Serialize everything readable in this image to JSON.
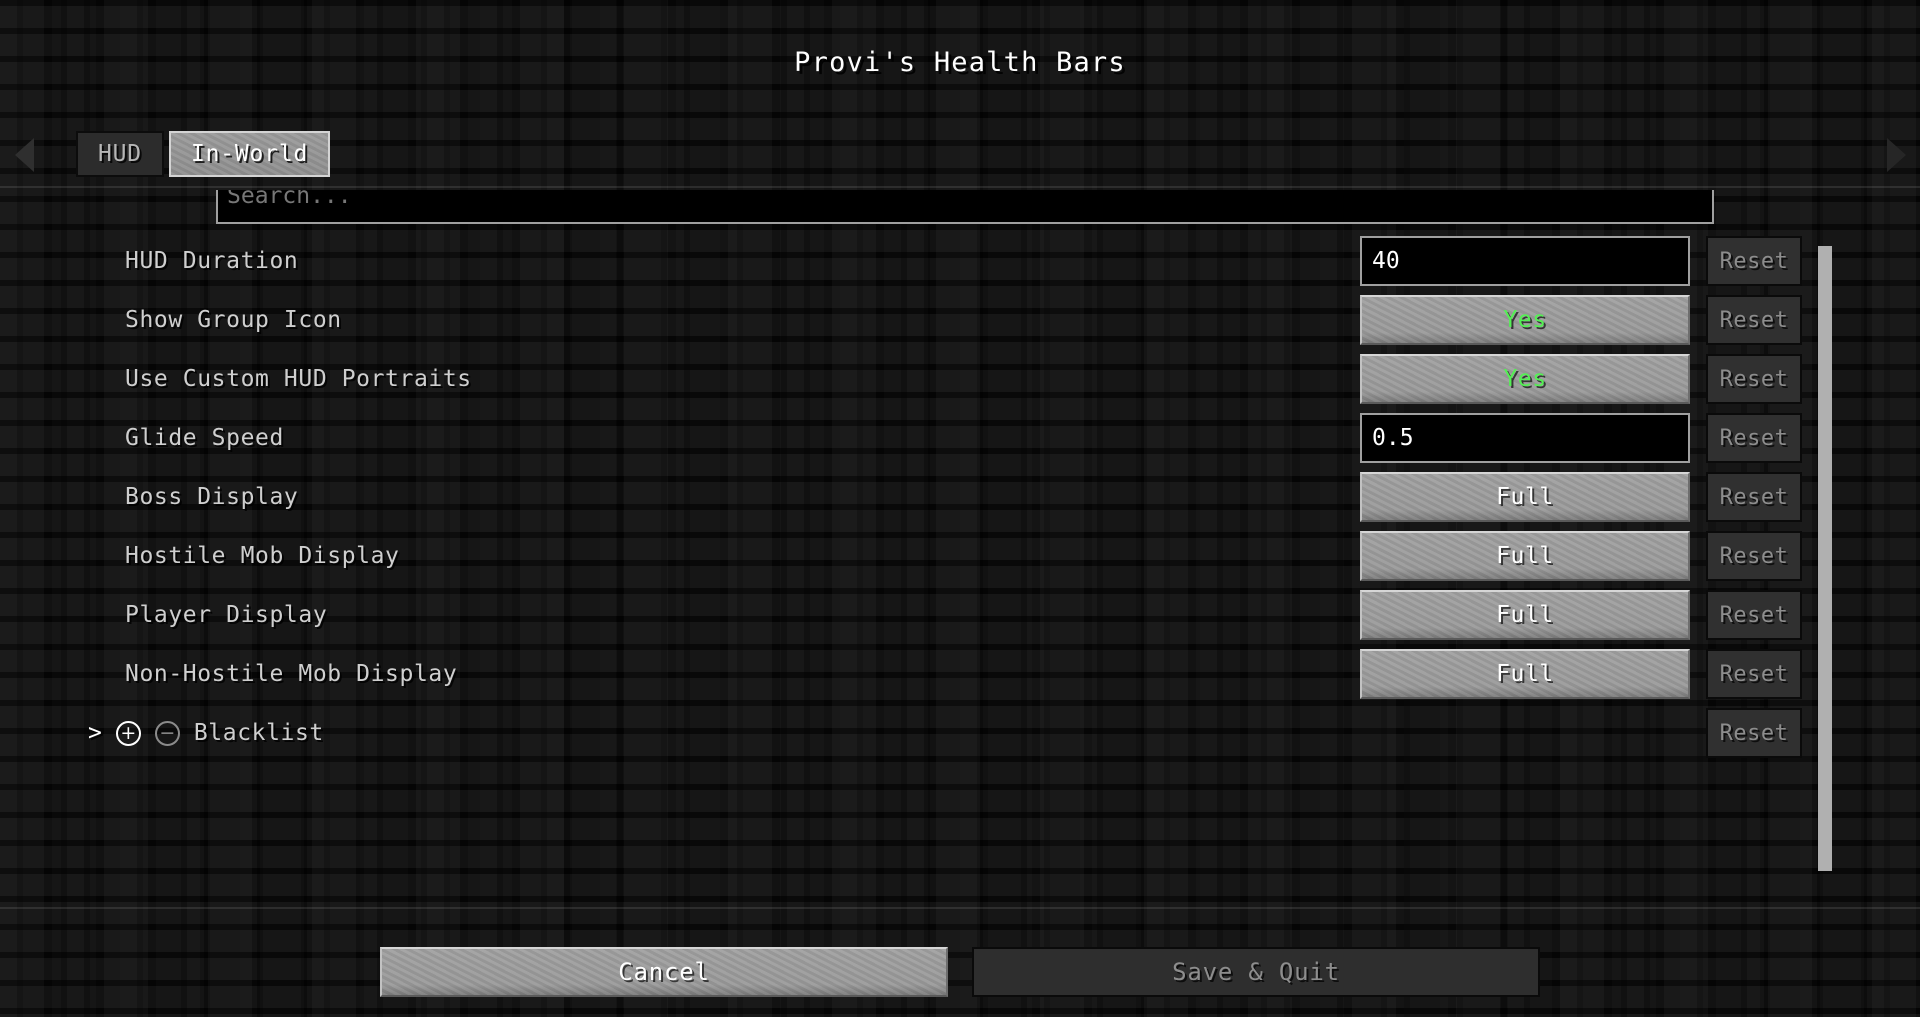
{
  "window": {
    "title": "Provi's Health Bars"
  },
  "tab_bar": {
    "prev_arrow_icon": "triangle-left-icon",
    "next_arrow_icon": "triangle-right-icon",
    "tabs": [
      {
        "label": "HUD",
        "active": false
      },
      {
        "label": "In-World",
        "active": true
      }
    ]
  },
  "search": {
    "placeholder": "Search...",
    "value": ""
  },
  "options": [
    {
      "label": "HUD Duration",
      "control_type": "text-field",
      "value": "40",
      "value_color": "#ffffff",
      "focused": true,
      "reset_label": "Reset",
      "reset_enabled": false
    },
    {
      "label": "Show Group Icon",
      "control_type": "cycle-button",
      "value": "Yes",
      "value_color": "#54f054",
      "reset_label": "Reset",
      "reset_enabled": false
    },
    {
      "label": "Use Custom HUD Portraits",
      "control_type": "cycle-button",
      "value": "Yes",
      "value_color": "#54f054",
      "reset_label": "Reset",
      "reset_enabled": false
    },
    {
      "label": "Glide Speed",
      "control_type": "text-field",
      "value": "0.5",
      "value_color": "#ffffff",
      "focused": false,
      "reset_label": "Reset",
      "reset_enabled": false
    },
    {
      "label": "Boss Display",
      "control_type": "cycle-button",
      "value": "Full",
      "value_color": "#ffffff",
      "reset_label": "Reset",
      "reset_enabled": false
    },
    {
      "label": "Hostile Mob Display",
      "control_type": "cycle-button",
      "value": "Full",
      "value_color": "#ffffff",
      "reset_label": "Reset",
      "reset_enabled": false
    },
    {
      "label": "Player Display",
      "control_type": "cycle-button",
      "value": "Full",
      "value_color": "#ffffff",
      "reset_label": "Reset",
      "reset_enabled": false
    },
    {
      "label": "Non-Hostile Mob Display",
      "control_type": "cycle-button",
      "value": "Full",
      "value_color": "#ffffff",
      "reset_label": "Reset",
      "reset_enabled": false
    }
  ],
  "category": {
    "label": "Blacklist",
    "expand_chevron": ">",
    "add_icon_glyph": "+",
    "remove_icon_glyph": "−",
    "reset_label": "Reset",
    "reset_enabled": false
  },
  "scrollbar": {
    "orientation": "vertical",
    "thumb_position_percent": 8
  },
  "footer": {
    "cancel_label": "Cancel",
    "save_quit_label": "Save & Quit",
    "save_quit_enabled": false
  },
  "colors": {
    "background": "#0a0a0a",
    "accent_green": "#54f054",
    "text_primary": "#cfcfcf",
    "text_bright": "#ffffff",
    "text_disabled": "#8d8d8d",
    "button_light": "#9a9a9a",
    "button_dark": "#2e2e2e",
    "scrollbar_thumb": "#b0b0b0"
  }
}
